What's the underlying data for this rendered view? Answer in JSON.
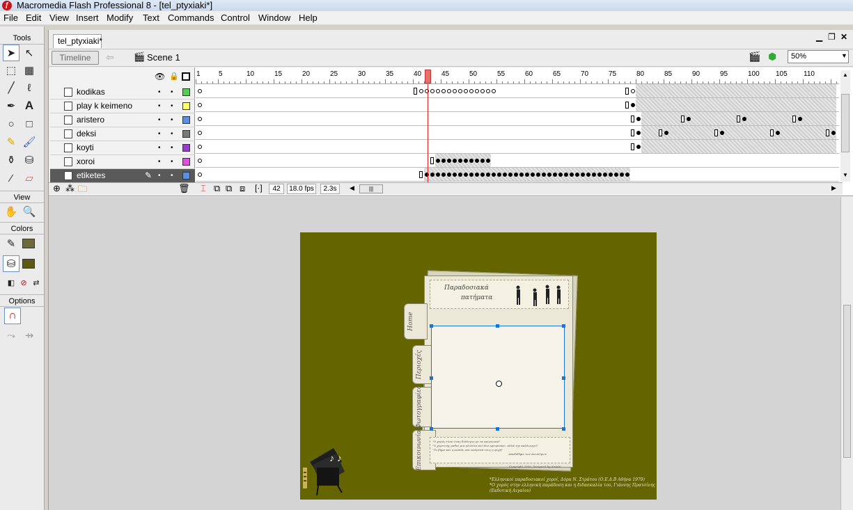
{
  "window": {
    "title": "Macromedia Flash Professional 8 - [tel_ptyxiaki*]"
  },
  "menu": [
    "File",
    "Edit",
    "View",
    "Insert",
    "Modify",
    "Text",
    "Commands",
    "Control",
    "Window",
    "Help"
  ],
  "tools_panel": {
    "title": "Tools",
    "view_label": "View",
    "colors_label": "Colors",
    "options_label": "Options",
    "stroke_color": "#6e6a3a",
    "fill_color": "#5a5a10"
  },
  "document": {
    "tab": "tel_ptyxiaki*",
    "timeline_button": "Timeline",
    "scene": "Scene 1",
    "zoom": "50%"
  },
  "timeline": {
    "ruler": [
      "1",
      "5",
      "10",
      "15",
      "20",
      "25",
      "30",
      "35",
      "40",
      "45",
      "50",
      "55",
      "60",
      "65",
      "70",
      "75",
      "80",
      "85",
      "90",
      "95",
      "100",
      "105",
      "110"
    ],
    "layers": [
      {
        "name": "kodikas",
        "color": "#4fd14f"
      },
      {
        "name": "play k keimeno",
        "color": "#ffff66"
      },
      {
        "name": "aristero",
        "color": "#5a8fe8"
      },
      {
        "name": "deksi",
        "color": "#7a7a7a"
      },
      {
        "name": "koyti",
        "color": "#9a3ad1"
      },
      {
        "name": "xoroi",
        "color": "#e04fe0"
      },
      {
        "name": "etiketes",
        "color": "#5a8fe8"
      }
    ],
    "current_frame": "42",
    "fps": "18.0 fps",
    "elapsed": "2.3s"
  },
  "stage": {
    "background": "#646400",
    "header_title_line1": "Παραδοσιακά",
    "header_title_line2": "πατήματα",
    "tabs": [
      "Home",
      "Περιοχές",
      "Φωτογραφίες",
      "Επικοινωνία"
    ],
    "quote_lines": [
      "\"Ο χορός είναι ένας διάλογος με τα προγονικά\"",
      "\"Ο χορευτής μαθαί μια γλώσσα που δεν εφευρίσκει, αλλά την καλλιεργεί\"",
      "\"Το βήμα και η ανάσα, και ανάμεσά τους η ψυχή\""
    ],
    "quote_author": "Αποδόθηκε των Ανωνύμων",
    "copyright": "Copyright 2009, Designed by Aroula",
    "credit_line1": "*Ελληνικοί παραδοσιακοί χοροί, Δόρα Ν. Στράτου (Ο.Ε.Δ.Β Αθήνα 1979)",
    "credit_line2": "*Ο χορός στην ελληνική παράδοση και η διδασκαλία του, Γιάννης Πρατσίνης",
    "credit_line3": "(Εκδοτική Αιγαίου)",
    "music_notes": "♪ ♪"
  }
}
